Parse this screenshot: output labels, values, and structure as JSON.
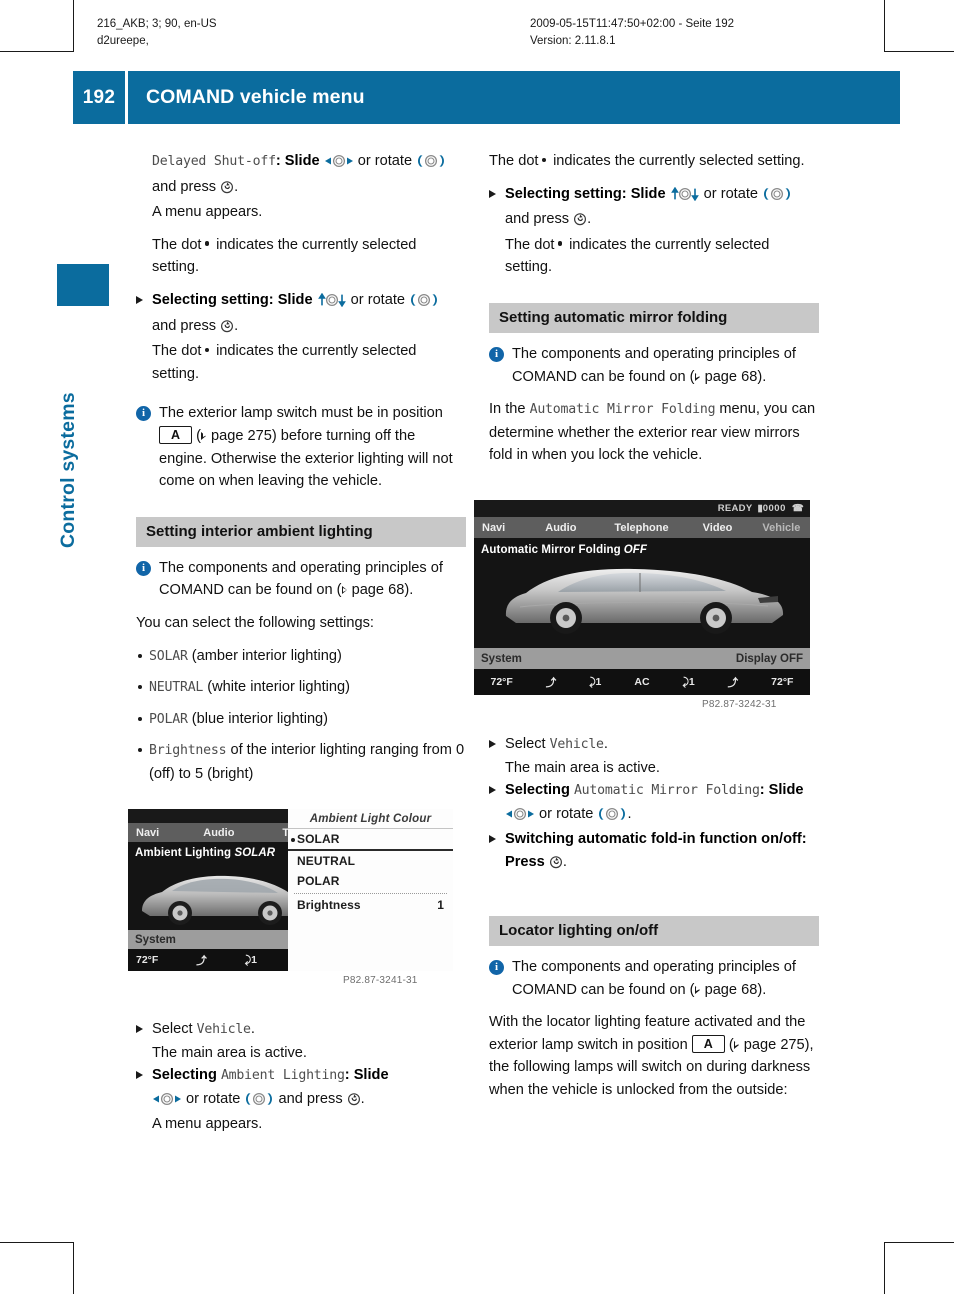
{
  "header": {
    "left_line1": "216_AKB; 3; 90, en-US",
    "left_line2": "d2ureepe,",
    "right_line1": "2009-05-15T11:47:50+02:00 - Seite 192",
    "right_line2": "Version: 2.11.8.1"
  },
  "title_band": {
    "page_number": "192",
    "title": "COMAND vehicle menu",
    "color": "#0b6c9e"
  },
  "chapter_tab": {
    "label": "Control systems"
  },
  "left_column": {
    "step_delayed_shutoff": {
      "term": "Delayed Shut-off",
      "text_a": ": Slide ",
      "text_b": " or rotate ",
      "text_c": " and press ",
      "text_d": ".",
      "result": "A menu appears."
    },
    "dot_note_1": {
      "before": "The dot",
      "after": "indicates the currently selected setting."
    },
    "step_selecting_setting": {
      "bold": "Selecting setting",
      "text_a": ": Slide ",
      "text_b": " or rotate ",
      "text_c": " and press ",
      "text_d": "."
    },
    "dot_note_2": {
      "before": "The dot",
      "after": "indicates the currently selected setting."
    },
    "note_lamp_switch": {
      "part1": "The exterior lamp switch must be in position",
      "symbol": "A",
      "xref": "page 275",
      "part2": ") before turning off the engine. Otherwise the exterior lighting will not come on when leaving the vehicle."
    },
    "section_ambient": {
      "heading": "Setting interior ambient lighting",
      "note": {
        "part1": "The components and operating principles of COMAND can be found on (",
        "xref": "page 68",
        "part2": ")."
      },
      "intro": "You can select the following settings:",
      "settings": [
        {
          "term": "SOLAR",
          "desc": " (amber interior lighting)"
        },
        {
          "term": "NEUTRAL",
          "desc": " (white interior lighting)"
        },
        {
          "term": "POLAR",
          "desc": " (blue interior lighting)"
        },
        {
          "term": "Brightness",
          "desc": " of the interior lighting ranging from 0 (off) to 5 (bright)"
        }
      ]
    },
    "screenshot_ambient": {
      "caption": "P82.87-3241-31",
      "menubar": [
        "Navi",
        "Audio",
        "Teleph"
      ],
      "main_title_bold": "Ambient Lighting ",
      "main_title_italic": "SOLAR",
      "sysbar_left": "System",
      "climate": [
        "72°F",
        "⤴",
        "⤸1"
      ],
      "popup": {
        "title": "Ambient Light Colour",
        "rows": [
          {
            "label": "SOLAR",
            "selected": true,
            "value": ""
          },
          {
            "label": "NEUTRAL",
            "selected": false,
            "value": ""
          },
          {
            "label": "POLAR",
            "selected": false,
            "value": ""
          },
          {
            "label": "Brightness",
            "selected": false,
            "value": "1"
          }
        ]
      }
    },
    "steps_ambient": {
      "select_label": "Select ",
      "select_term": "Vehicle",
      "select_end": ".",
      "select_result": "The main area is active.",
      "selecting_bold": "Selecting ",
      "selecting_term": "Ambient Lighting",
      "selecting_a": ": Slide ",
      "selecting_b": " or rotate ",
      "selecting_c": " and press ",
      "selecting_d": ".",
      "selecting_result": "A menu appears."
    }
  },
  "right_column": {
    "dot_note_1": {
      "before": "The dot",
      "after": "indicates the currently selected setting."
    },
    "step_selecting_setting": {
      "bold": "Selecting setting",
      "text_a": ": Slide ",
      "text_b": " or rotate ",
      "text_c": " and press ",
      "text_d": "."
    },
    "dot_note_2": {
      "before": "The dot",
      "after": "indicates the currently selected setting."
    },
    "section_mirror": {
      "heading": "Setting automatic mirror folding",
      "note": {
        "part1": "The components and operating principles of COMAND can be found on (",
        "xref": "page 68",
        "part2": ")."
      },
      "intro_a": "In the ",
      "intro_term": "Automatic Mirror Folding",
      "intro_b": " menu, you can determine whether the exterior rear view mirrors fold in when you lock the vehicle."
    },
    "screenshot_mirror": {
      "caption": "P82.87-3242-31",
      "status": "READY █00༎0",
      "status_text": "READY",
      "status_counter": "0000",
      "menubar": [
        "Navi",
        "Audio",
        "Telephone",
        "Video",
        "Vehicle"
      ],
      "menubar_active": "Vehicle",
      "main_title_bold": "Automatic Mirror Folding",
      "main_title_italic": "OFF",
      "sysbar_left": "System",
      "sysbar_right": "Display OFF",
      "climate": [
        "72°F",
        "⤴",
        "⤸1",
        "AC",
        "⤸1",
        "⤴",
        "72°F"
      ]
    },
    "steps_mirror": {
      "select_label": "Select ",
      "select_term": "Vehicle",
      "select_end": ".",
      "select_result": "The main area is active.",
      "selecting_bold": "Selecting ",
      "selecting_term": "Automatic Mirror Folding",
      "selecting_a": ": Slide ",
      "selecting_b": " or rotate ",
      "selecting_c": ".",
      "switching_bold": "Switching automatic fold-in function on/off",
      "switching_a": ": Press ",
      "switching_b": "."
    },
    "section_locator": {
      "heading": "Locator lighting on/off",
      "note": {
        "part1": "The components and operating principles of COMAND can be found on (",
        "xref": "page 68",
        "part2": ")."
      },
      "body_a": "With the locator lighting feature activated and the exterior lamp switch in position",
      "symbol": "A",
      "xref": "page 275",
      "body_b": "), the following lamps will switch on during darkness when the vehicle is unlocked from the outside:"
    }
  }
}
